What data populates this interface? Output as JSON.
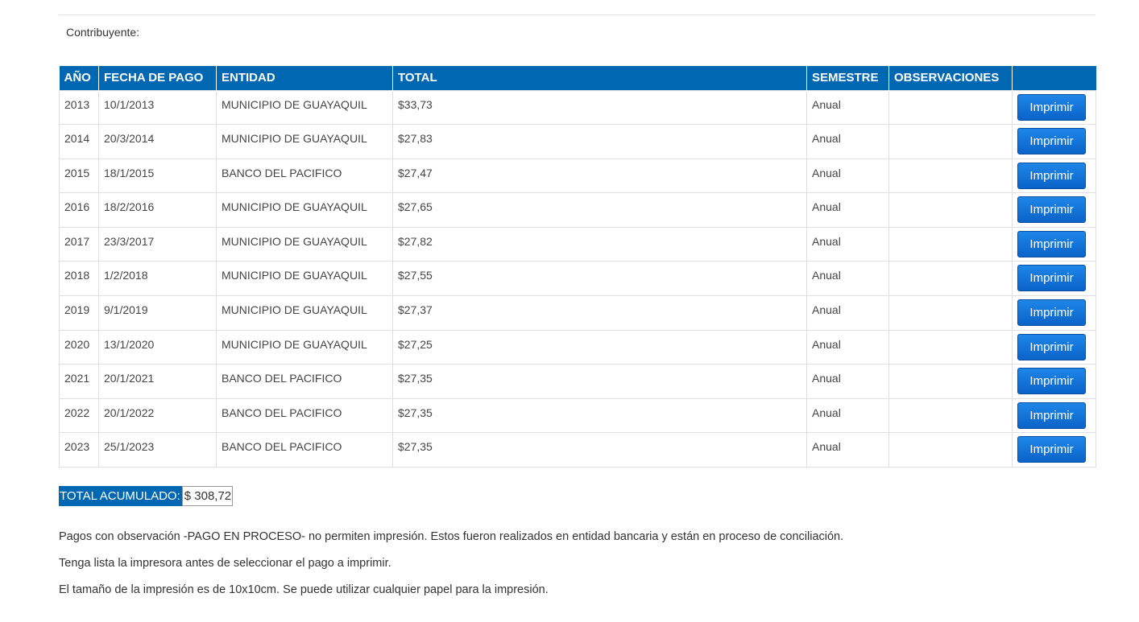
{
  "header": {
    "taxpayer_label": "Contribuyente:"
  },
  "table": {
    "columns": [
      "AÑO",
      "FECHA DE PAGO",
      "ENTIDAD",
      "TOTAL",
      "SEMESTRE",
      "OBSERVACIONES",
      ""
    ],
    "rows": [
      {
        "year": "2013",
        "date": "10/1/2013",
        "entity": "MUNICIPIO DE GUAYAQUIL",
        "total": "$33,73",
        "semester": "Anual",
        "observations": "",
        "action": "Imprimir"
      },
      {
        "year": "2014",
        "date": "20/3/2014",
        "entity": "MUNICIPIO DE GUAYAQUIL",
        "total": "$27,83",
        "semester": "Anual",
        "observations": "",
        "action": "Imprimir"
      },
      {
        "year": "2015",
        "date": "18/1/2015",
        "entity": "BANCO DEL PACIFICO",
        "total": "$27,47",
        "semester": "Anual",
        "observations": "",
        "action": "Imprimir"
      },
      {
        "year": "2016",
        "date": "18/2/2016",
        "entity": "MUNICIPIO DE GUAYAQUIL",
        "total": "$27,65",
        "semester": "Anual",
        "observations": "",
        "action": "Imprimir"
      },
      {
        "year": "2017",
        "date": "23/3/2017",
        "entity": "MUNICIPIO DE GUAYAQUIL",
        "total": "$27,82",
        "semester": "Anual",
        "observations": "",
        "action": "Imprimir"
      },
      {
        "year": "2018",
        "date": "1/2/2018",
        "entity": "MUNICIPIO DE GUAYAQUIL",
        "total": "$27,55",
        "semester": "Anual",
        "observations": "",
        "action": "Imprimir"
      },
      {
        "year": "2019",
        "date": "9/1/2019",
        "entity": "MUNICIPIO DE GUAYAQUIL",
        "total": "$27,37",
        "semester": "Anual",
        "observations": "",
        "action": "Imprimir"
      },
      {
        "year": "2020",
        "date": "13/1/2020",
        "entity": "MUNICIPIO DE GUAYAQUIL",
        "total": "$27,25",
        "semester": "Anual",
        "observations": "",
        "action": "Imprimir"
      },
      {
        "year": "2021",
        "date": "20/1/2021",
        "entity": "BANCO DEL PACIFICO",
        "total": "$27,35",
        "semester": "Anual",
        "observations": "",
        "action": "Imprimir"
      },
      {
        "year": "2022",
        "date": "20/1/2022",
        "entity": "BANCO DEL PACIFICO",
        "total": "$27,35",
        "semester": "Anual",
        "observations": "",
        "action": "Imprimir"
      },
      {
        "year": "2023",
        "date": "25/1/2023",
        "entity": "BANCO DEL PACIFICO",
        "total": "$27,35",
        "semester": "Anual",
        "observations": "",
        "action": "Imprimir"
      }
    ]
  },
  "summary": {
    "total_label": "TOTAL ACUMULADO:",
    "total_value": "$ 308,72"
  },
  "notes": [
    "Pagos con observación -PAGO EN PROCESO- no permiten impresión. Estos fueron realizados en entidad bancaria y están en proceso de conciliación.",
    "Tenga lista la impresora antes de seleccionar el pago a imprimir.",
    "El tamaño de la impresión es de 10x10cm. Se puede utilizar cualquier papel para la impresión."
  ],
  "colors": {
    "header_bg": "#0068b3",
    "button_bg": "#0a63c9",
    "border": "#e0e0e0"
  }
}
